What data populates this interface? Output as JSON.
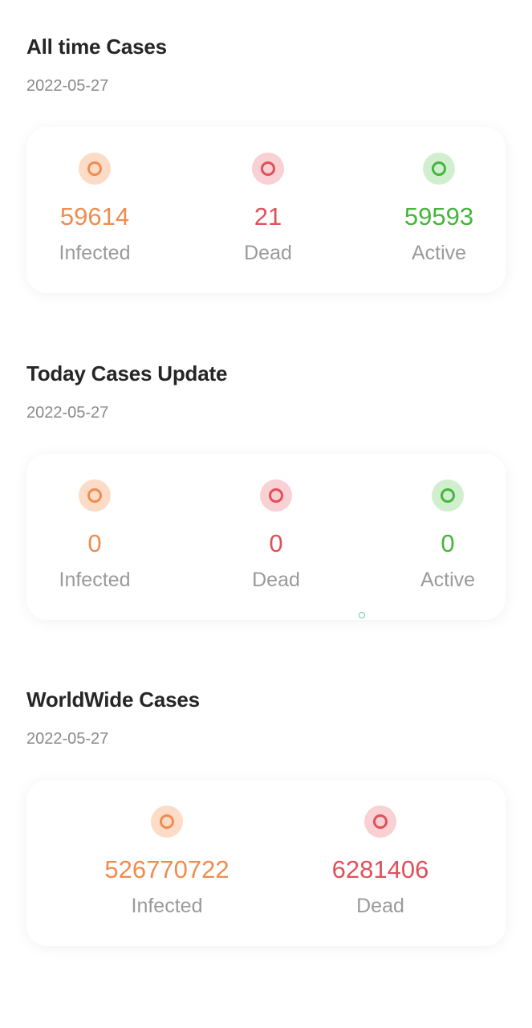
{
  "all_time": {
    "title": "All time Cases",
    "date": "2022-05-27",
    "infected": {
      "value": "59614",
      "label": "Infected"
    },
    "dead": {
      "value": "21",
      "label": "Dead"
    },
    "active": {
      "value": "59593",
      "label": "Active"
    }
  },
  "today": {
    "title": "Today Cases Update",
    "date": "2022-05-27",
    "infected": {
      "value": "0",
      "label": "Infected"
    },
    "dead": {
      "value": "0",
      "label": "Dead"
    },
    "active": {
      "value": "0",
      "label": "Active"
    }
  },
  "worldwide": {
    "title": "WorldWide Cases",
    "date": "2022-05-27",
    "infected": {
      "value": "526770722",
      "label": "Infected"
    },
    "dead": {
      "value": "6281406",
      "label": "Dead"
    }
  },
  "colors": {
    "infected": "#ef8c4f",
    "dead": "#e0505a",
    "active": "#45b53c"
  }
}
